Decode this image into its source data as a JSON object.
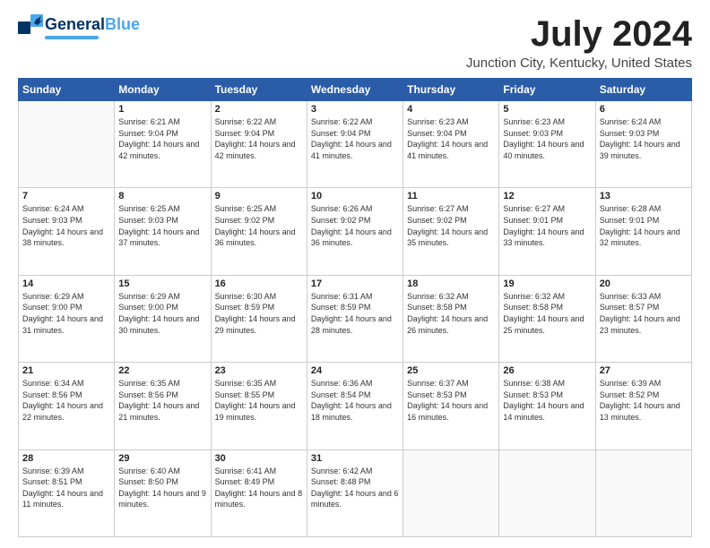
{
  "header": {
    "logo": {
      "line1": "General",
      "line2": "Blue"
    },
    "title": "July 2024",
    "location": "Junction City, Kentucky, United States"
  },
  "weekdays": [
    "Sunday",
    "Monday",
    "Tuesday",
    "Wednesday",
    "Thursday",
    "Friday",
    "Saturday"
  ],
  "weeks": [
    [
      {
        "day": "",
        "sunrise": "",
        "sunset": "",
        "daylight": ""
      },
      {
        "day": "1",
        "sunrise": "Sunrise: 6:21 AM",
        "sunset": "Sunset: 9:04 PM",
        "daylight": "Daylight: 14 hours and 42 minutes."
      },
      {
        "day": "2",
        "sunrise": "Sunrise: 6:22 AM",
        "sunset": "Sunset: 9:04 PM",
        "daylight": "Daylight: 14 hours and 42 minutes."
      },
      {
        "day": "3",
        "sunrise": "Sunrise: 6:22 AM",
        "sunset": "Sunset: 9:04 PM",
        "daylight": "Daylight: 14 hours and 41 minutes."
      },
      {
        "day": "4",
        "sunrise": "Sunrise: 6:23 AM",
        "sunset": "Sunset: 9:04 PM",
        "daylight": "Daylight: 14 hours and 41 minutes."
      },
      {
        "day": "5",
        "sunrise": "Sunrise: 6:23 AM",
        "sunset": "Sunset: 9:03 PM",
        "daylight": "Daylight: 14 hours and 40 minutes."
      },
      {
        "day": "6",
        "sunrise": "Sunrise: 6:24 AM",
        "sunset": "Sunset: 9:03 PM",
        "daylight": "Daylight: 14 hours and 39 minutes."
      }
    ],
    [
      {
        "day": "7",
        "sunrise": "Sunrise: 6:24 AM",
        "sunset": "Sunset: 9:03 PM",
        "daylight": "Daylight: 14 hours and 38 minutes."
      },
      {
        "day": "8",
        "sunrise": "Sunrise: 6:25 AM",
        "sunset": "Sunset: 9:03 PM",
        "daylight": "Daylight: 14 hours and 37 minutes."
      },
      {
        "day": "9",
        "sunrise": "Sunrise: 6:25 AM",
        "sunset": "Sunset: 9:02 PM",
        "daylight": "Daylight: 14 hours and 36 minutes."
      },
      {
        "day": "10",
        "sunrise": "Sunrise: 6:26 AM",
        "sunset": "Sunset: 9:02 PM",
        "daylight": "Daylight: 14 hours and 36 minutes."
      },
      {
        "day": "11",
        "sunrise": "Sunrise: 6:27 AM",
        "sunset": "Sunset: 9:02 PM",
        "daylight": "Daylight: 14 hours and 35 minutes."
      },
      {
        "day": "12",
        "sunrise": "Sunrise: 6:27 AM",
        "sunset": "Sunset: 9:01 PM",
        "daylight": "Daylight: 14 hours and 33 minutes."
      },
      {
        "day": "13",
        "sunrise": "Sunrise: 6:28 AM",
        "sunset": "Sunset: 9:01 PM",
        "daylight": "Daylight: 14 hours and 32 minutes."
      }
    ],
    [
      {
        "day": "14",
        "sunrise": "Sunrise: 6:29 AM",
        "sunset": "Sunset: 9:00 PM",
        "daylight": "Daylight: 14 hours and 31 minutes."
      },
      {
        "day": "15",
        "sunrise": "Sunrise: 6:29 AM",
        "sunset": "Sunset: 9:00 PM",
        "daylight": "Daylight: 14 hours and 30 minutes."
      },
      {
        "day": "16",
        "sunrise": "Sunrise: 6:30 AM",
        "sunset": "Sunset: 8:59 PM",
        "daylight": "Daylight: 14 hours and 29 minutes."
      },
      {
        "day": "17",
        "sunrise": "Sunrise: 6:31 AM",
        "sunset": "Sunset: 8:59 PM",
        "daylight": "Daylight: 14 hours and 28 minutes."
      },
      {
        "day": "18",
        "sunrise": "Sunrise: 6:32 AM",
        "sunset": "Sunset: 8:58 PM",
        "daylight": "Daylight: 14 hours and 26 minutes."
      },
      {
        "day": "19",
        "sunrise": "Sunrise: 6:32 AM",
        "sunset": "Sunset: 8:58 PM",
        "daylight": "Daylight: 14 hours and 25 minutes."
      },
      {
        "day": "20",
        "sunrise": "Sunrise: 6:33 AM",
        "sunset": "Sunset: 8:57 PM",
        "daylight": "Daylight: 14 hours and 23 minutes."
      }
    ],
    [
      {
        "day": "21",
        "sunrise": "Sunrise: 6:34 AM",
        "sunset": "Sunset: 8:56 PM",
        "daylight": "Daylight: 14 hours and 22 minutes."
      },
      {
        "day": "22",
        "sunrise": "Sunrise: 6:35 AM",
        "sunset": "Sunset: 8:56 PM",
        "daylight": "Daylight: 14 hours and 21 minutes."
      },
      {
        "day": "23",
        "sunrise": "Sunrise: 6:35 AM",
        "sunset": "Sunset: 8:55 PM",
        "daylight": "Daylight: 14 hours and 19 minutes."
      },
      {
        "day": "24",
        "sunrise": "Sunrise: 6:36 AM",
        "sunset": "Sunset: 8:54 PM",
        "daylight": "Daylight: 14 hours and 18 minutes."
      },
      {
        "day": "25",
        "sunrise": "Sunrise: 6:37 AM",
        "sunset": "Sunset: 8:53 PM",
        "daylight": "Daylight: 14 hours and 16 minutes."
      },
      {
        "day": "26",
        "sunrise": "Sunrise: 6:38 AM",
        "sunset": "Sunset: 8:53 PM",
        "daylight": "Daylight: 14 hours and 14 minutes."
      },
      {
        "day": "27",
        "sunrise": "Sunrise: 6:39 AM",
        "sunset": "Sunset: 8:52 PM",
        "daylight": "Daylight: 14 hours and 13 minutes."
      }
    ],
    [
      {
        "day": "28",
        "sunrise": "Sunrise: 6:39 AM",
        "sunset": "Sunset: 8:51 PM",
        "daylight": "Daylight: 14 hours and 11 minutes."
      },
      {
        "day": "29",
        "sunrise": "Sunrise: 6:40 AM",
        "sunset": "Sunset: 8:50 PM",
        "daylight": "Daylight: 14 hours and 9 minutes."
      },
      {
        "day": "30",
        "sunrise": "Sunrise: 6:41 AM",
        "sunset": "Sunset: 8:49 PM",
        "daylight": "Daylight: 14 hours and 8 minutes."
      },
      {
        "day": "31",
        "sunrise": "Sunrise: 6:42 AM",
        "sunset": "Sunset: 8:48 PM",
        "daylight": "Daylight: 14 hours and 6 minutes."
      },
      {
        "day": "",
        "sunrise": "",
        "sunset": "",
        "daylight": ""
      },
      {
        "day": "",
        "sunrise": "",
        "sunset": "",
        "daylight": ""
      },
      {
        "day": "",
        "sunrise": "",
        "sunset": "",
        "daylight": ""
      }
    ]
  ]
}
